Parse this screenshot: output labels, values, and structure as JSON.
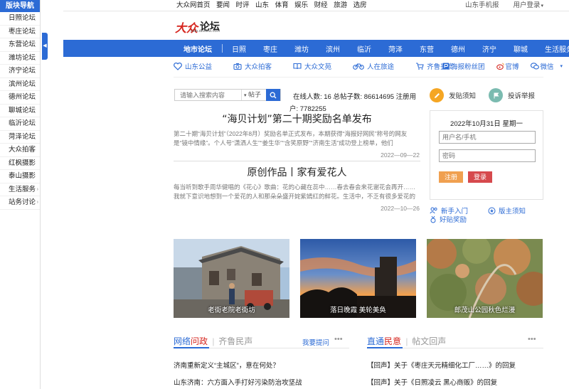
{
  "sidebar": {
    "header": "版块导航",
    "items": [
      {
        "label": "日照论坛",
        "caret": false
      },
      {
        "label": "枣庄论坛",
        "caret": false
      },
      {
        "label": "东营论坛",
        "caret": false
      },
      {
        "label": "潍坊论坛",
        "caret": false
      },
      {
        "label": "济宁论坛",
        "caret": false
      },
      {
        "label": "滨州论坛",
        "caret": false
      },
      {
        "label": "德州论坛",
        "caret": false
      },
      {
        "label": "聊城论坛",
        "caret": false
      },
      {
        "label": "临沂论坛",
        "caret": false
      },
      {
        "label": "菏泽论坛",
        "caret": false
      },
      {
        "label": "大众拍客",
        "caret": false
      },
      {
        "label": "红枫摄影",
        "caret": false
      },
      {
        "label": "泰山摄影",
        "caret": false
      },
      {
        "label": "生活服务",
        "caret": true
      },
      {
        "label": "站务讨论",
        "caret": true
      }
    ]
  },
  "topbar": {
    "links": [
      "大众网首页",
      "要闻",
      "时评",
      "山东",
      "体育",
      "娱乐",
      "财经",
      "旅游",
      "选房"
    ],
    "mobile": "山东手机报",
    "login": "用户登录"
  },
  "logo": {
    "mark": "大众",
    "forum": "论坛",
    "url": "club.dzwww.com"
  },
  "nav": {
    "first": "地市论坛",
    "items": [
      "日照",
      "枣庄",
      "潍坊",
      "滨州",
      "临沂",
      "菏泽",
      "东营",
      "德州",
      "济宁",
      "聊城",
      "生活服务"
    ]
  },
  "subnav": {
    "items": [
      {
        "label": "山东公益",
        "icon": "heart-icon"
      },
      {
        "label": "大众拍客",
        "icon": "camera-icon"
      },
      {
        "label": "大众文苑",
        "icon": "book-icon"
      },
      {
        "label": "人在旅途",
        "icon": "bicycle-icon"
      },
      {
        "label": "齐鲁鉴赏",
        "icon": "cart-icon"
      }
    ],
    "fans": "海报粉丝团",
    "weibo": "官博",
    "wechat": "微信"
  },
  "search": {
    "placeholder": "请输入搜索内容",
    "type": "帖子"
  },
  "stats": {
    "line1": "在线人数: 16  总帖子数: 86614695  注册用",
    "line2": "户: 7782255"
  },
  "articles": [
    {
      "title": "“海贝计划”第二十期奖励名单发布",
      "summary": "第二十期“海贝计划”（2022年8月）奖励名单正式发布，本期获得“海报好网民”称号的网友是“镜中情缘”。个人号“潇洒人生”“姜生华”“含笑原野”“济南生活”成功登上榜单，他们",
      "date": "2022—09—22"
    },
    {
      "title": "原创作品丨家有爱花人",
      "summary": "每当听到歌手周华健唱的《花心》歌曲：花的心藏在蕊中……春去春会来花谢花会再开……我就下意识地想到一个爱花的人和那朵朵盛开姹紫嫣红的鲜花。生活中，不乏有很多爱花的",
      "date": "2022—10—26"
    }
  ],
  "right_panel": {
    "post_notice": "发贴须知",
    "complaint": "投诉举报",
    "date": "2022年10月31日 星期一",
    "username_placeholder": "用户名/手机",
    "password_placeholder": "密码",
    "register": "注册",
    "login": "登录",
    "help": [
      "新手入门",
      "版主须知",
      "好贴奖励"
    ]
  },
  "photos": [
    {
      "caption": "老街老院老街坊"
    },
    {
      "caption": "落日晚霞 美轮美奂"
    },
    {
      "caption": "郎茂山公园秋色烂漫"
    }
  ],
  "section_left": {
    "title_a": "网络",
    "title_b": "问政",
    "title_c": "齐鲁民声",
    "ask": "我要提问",
    "items": [
      "济南重新定义“主城区”，意在何处？",
      "山东济南：六方面入手打好污染防治攻坚战"
    ]
  },
  "section_right": {
    "title_a": "直通",
    "title_b": "民意",
    "title_c": "帖文回声",
    "items": [
      "【回声】关于《枣庄天元精细化工厂……》的回复",
      "【回声】关于《日照凌云 黑心商贩》的回复"
    ]
  },
  "colors": {
    "brand_blue": "#2c6bd5",
    "red": "#d6261f",
    "orange": "#f0a050"
  }
}
